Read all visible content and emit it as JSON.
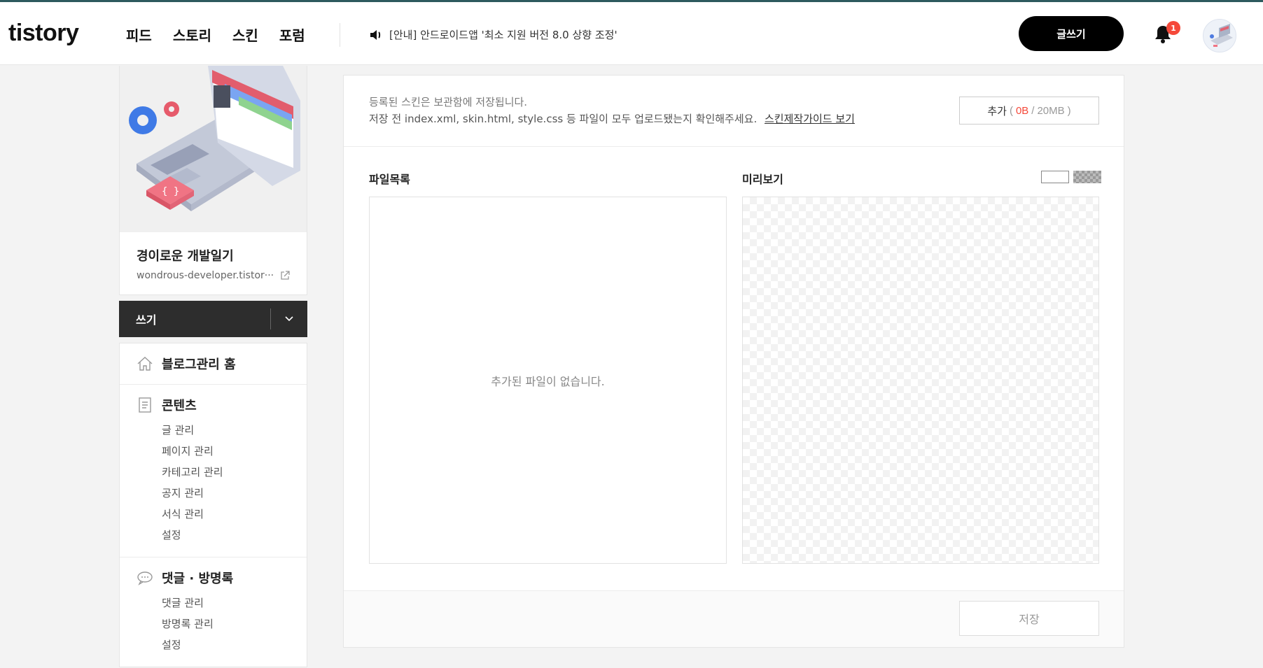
{
  "header": {
    "logo": "tistory",
    "nav": [
      "피드",
      "스토리",
      "스킨",
      "포럼"
    ],
    "notice": "[안내] 안드로이드앱 '최소 지원 버전 8.0 상향 조정'",
    "write_button": "글쓰기",
    "notification_count": "1"
  },
  "sidebar": {
    "blog_title": "경이로운 개발일기",
    "blog_url": "wondrous-developer.tistor···",
    "write_label": "쓰기",
    "home_label": "블로그관리 홈",
    "sections": [
      {
        "title": "콘텐츠",
        "items": [
          "글 관리",
          "페이지 관리",
          "카테고리 관리",
          "공지 관리",
          "서식 관리",
          "설정"
        ]
      },
      {
        "title": "댓글 · 방명록",
        "items": [
          "댓글 관리",
          "방명록 관리",
          "설정"
        ]
      }
    ]
  },
  "main": {
    "guide_line1": "등록된 스킨은 보관함에 저장됩니다.",
    "guide_line2": "저장 전 index.xml, skin.html, style.css 등 파일이 모두 업로드됐는지 확인해주세요.",
    "guide_link": "스킨제작가이드 보기",
    "add_button": {
      "label": "추가",
      "open": "(",
      "used": "0B",
      "sep": "/",
      "limit": "20MB",
      "close": ")"
    },
    "files_label": "파일목록",
    "preview_label": "미리보기",
    "empty_files": "추가된 파일이 없습니다.",
    "save_button": "저장"
  },
  "colors": {
    "accent_line": "#2d5a5e",
    "badge": "#f5493a",
    "write_bar": "#2d2d2d"
  }
}
